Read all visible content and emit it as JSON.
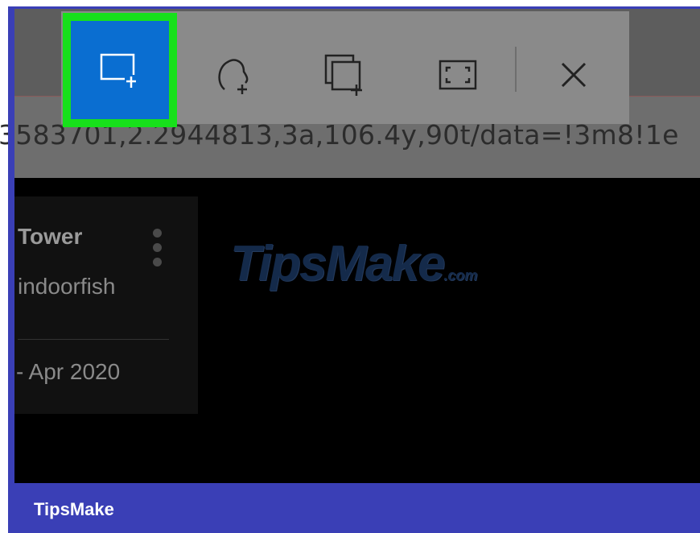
{
  "url_text": "3583701,2.2944813,3a,106.4y,90t/data=!3m8!1e",
  "card": {
    "title": "Tower",
    "subtitle": "indoorfish",
    "date": "- Apr 2020"
  },
  "watermark": {
    "main": "TipsMake",
    "suffix": ".com"
  },
  "toolbar": {
    "tools": [
      {
        "icon": "rectangular-snip-icon",
        "active": true
      },
      {
        "icon": "freeform-snip-icon",
        "active": false
      },
      {
        "icon": "window-snip-icon",
        "active": false
      },
      {
        "icon": "fullscreen-snip-icon",
        "active": false
      },
      {
        "icon": "close-icon",
        "active": false
      }
    ]
  },
  "footer": {
    "brand": "TipsMake"
  },
  "colors": {
    "accent_blue": "#0a6ed1",
    "highlight_green": "#17e01b",
    "brand_bar": "#3a3fb6"
  }
}
